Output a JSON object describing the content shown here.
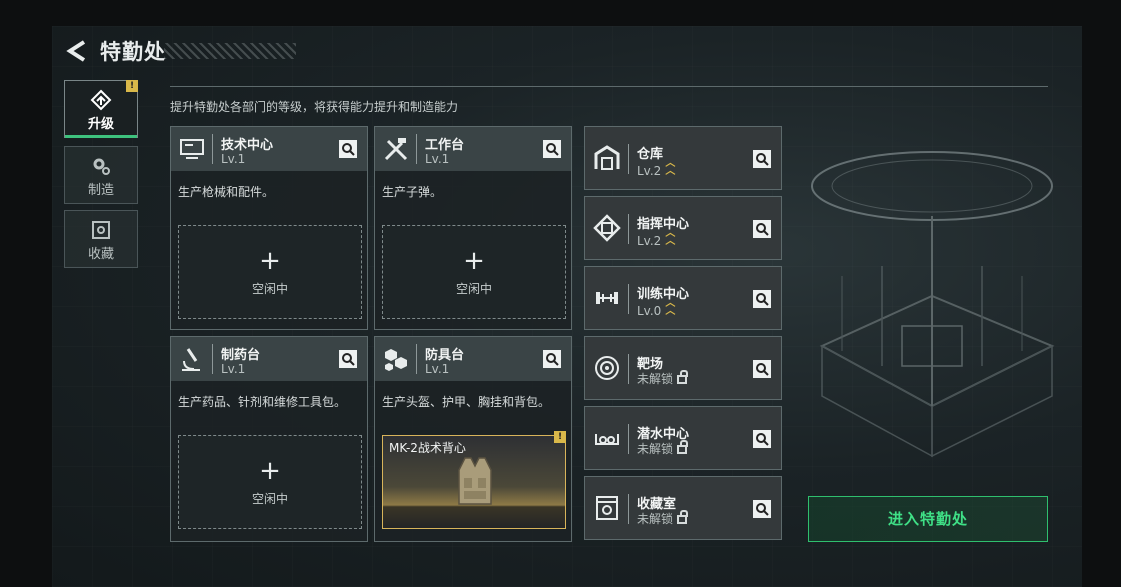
{
  "header": {
    "title": "特勤处"
  },
  "sidebar": {
    "items": [
      {
        "label": "升级",
        "badge": "!",
        "active": true
      },
      {
        "label": "制造"
      },
      {
        "label": "收藏"
      }
    ]
  },
  "description": "提升特勤处各部门的等级，将获得能力提升和制造能力",
  "stations": [
    {
      "name": "技术中心",
      "level": "Lv.1",
      "desc": "生产枪械和配件。",
      "slot": {
        "plus": "+",
        "status": "空闲中"
      }
    },
    {
      "name": "工作台",
      "level": "Lv.1",
      "desc": "生产子弹。",
      "slot": {
        "plus": "+",
        "status": "空闲中"
      }
    },
    {
      "name": "制药台",
      "level": "Lv.1",
      "desc": "生产药品、针剂和维修工具包。",
      "slot": {
        "plus": "+",
        "status": "空闲中"
      }
    },
    {
      "name": "防具台",
      "level": "Lv.1",
      "desc": "生产头盔、护甲、胸挂和背包。",
      "blueprint": {
        "name": "MK-2战术背心",
        "badge": "!"
      }
    }
  ],
  "facilities": [
    {
      "name": "仓库",
      "level": "Lv.2",
      "upgradable": true
    },
    {
      "name": "指挥中心",
      "level": "Lv.2",
      "upgradable": true
    },
    {
      "name": "训练中心",
      "level": "Lv.0",
      "upgradable": true
    },
    {
      "name": "靶场",
      "level": "未解锁",
      "locked": true
    },
    {
      "name": "潜水中心",
      "level": "未解锁",
      "locked": true
    },
    {
      "name": "收藏室",
      "level": "未解锁",
      "locked": true
    }
  ],
  "enter_button": "进入特勤处",
  "colors": {
    "accent": "#3ec27e",
    "badge": "#d9b84a",
    "panel": "#34393b"
  }
}
